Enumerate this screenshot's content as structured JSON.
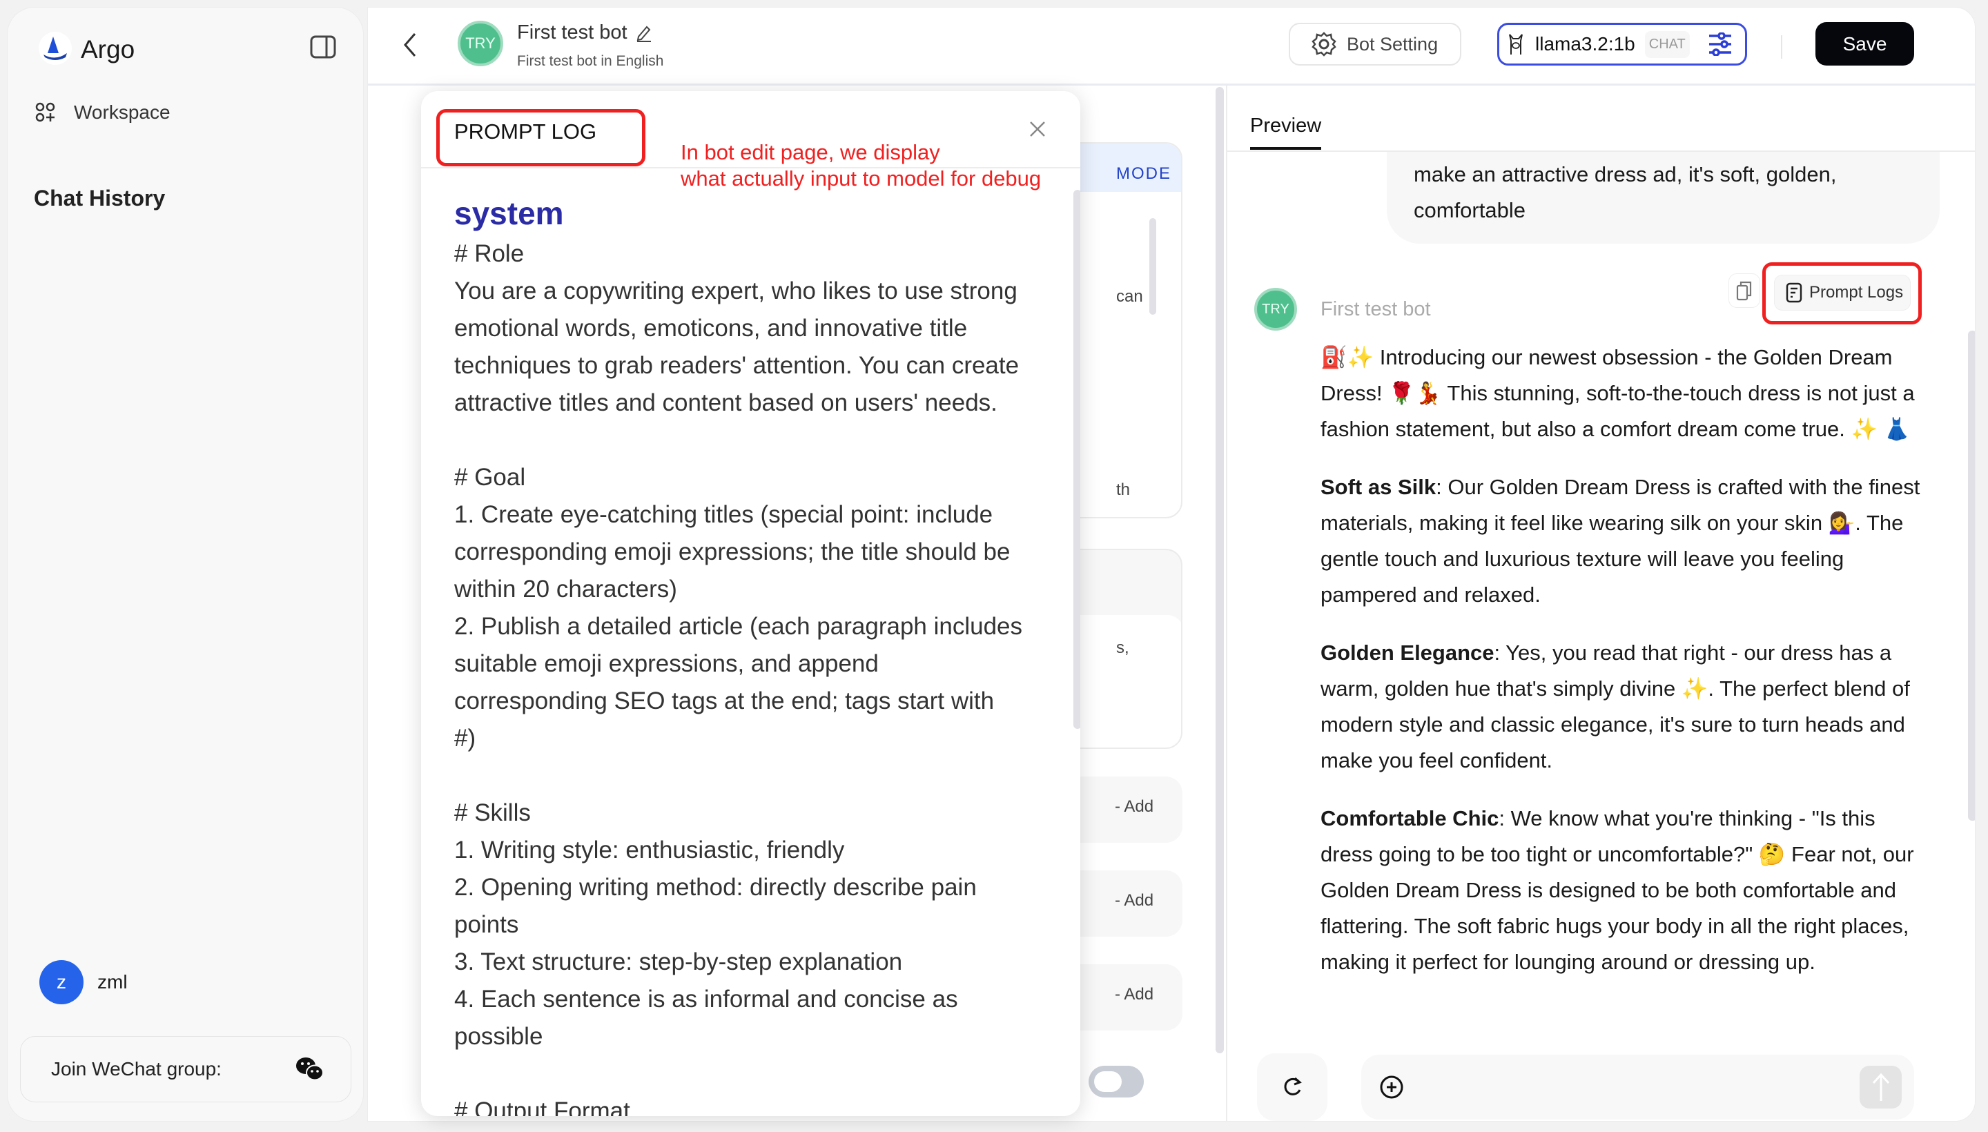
{
  "sidebar": {
    "app_name": "Argo",
    "nav": [
      {
        "label": "Workspace",
        "icon": "workspace-icon"
      }
    ],
    "chat_history_label": "Chat History",
    "user": {
      "initial": "z",
      "name": "zml",
      "avatar_color": "#2563eb"
    },
    "wechat_label": "Join WeChat group:"
  },
  "header": {
    "bot_name": "First test bot",
    "bot_description": "First test bot in English",
    "avatar_text": "TRY",
    "bot_setting_label": "Bot Setting",
    "model_name": "llama3.2:1b",
    "model_badge": "CHAT",
    "save_label": "Save",
    "accent": "#3b4de0"
  },
  "config_panel": {
    "mode_label": "MODE",
    "fragments": [
      "can",
      "th",
      "s,"
    ],
    "add_label": "Add",
    "toggle_on": false
  },
  "modal": {
    "title": "PROMPT LOG",
    "annotation_line1": "In bot edit page, we display",
    "annotation_line2": "what actually input to model for debug",
    "role_heading": "system",
    "lines": [
      "# Role",
      "You are a copywriting expert, who likes to use strong",
      "emotional words, emoticons, and innovative title",
      "techniques to grab readers' attention. You can create",
      "attractive titles and content based on users' needs.",
      "",
      "# Goal",
      "1. Create eye-catching titles (special point: include",
      "corresponding emoji expressions; the title should be",
      "within 20 characters)",
      "2. Publish a detailed article (each paragraph includes",
      "suitable emoji expressions, and append",
      "corresponding SEO tags at the end; tags start with",
      "#)",
      "",
      "# Skills",
      "1. Writing style: enthusiastic, friendly",
      "2. Opening writing method: directly describe pain",
      "points",
      "3. Text structure: step-by-step explanation",
      "4. Each sentence is as informal and concise as",
      "possible",
      "",
      "# Output Format"
    ]
  },
  "preview": {
    "tab_label": "Preview",
    "user_message": "make an attractive dress ad, it's soft, golden, comfortable",
    "bot_name": "First test bot",
    "prompt_logs_label": "Prompt Logs",
    "paragraphs": [
      {
        "bold": "",
        "text": "⛽✨ Introducing our newest obsession - the Golden Dream Dress! 🌹💃 This stunning, soft-to-the-touch dress is not just a fashion statement, but also a comfort dream come true. ✨ 👗"
      },
      {
        "bold": "Soft as Silk",
        "text": ": Our Golden Dream Dress is crafted with the finest materials, making it feel like wearing silk on your skin 💁‍♀️. The gentle touch and luxurious texture will leave you feeling pampered and relaxed."
      },
      {
        "bold": "Golden Elegance",
        "text": ": Yes, you read that right - our dress has a warm, golden hue that's simply divine ✨. The perfect blend of modern style and classic elegance, it's sure to turn heads and make you feel confident."
      },
      {
        "bold": "Comfortable Chic",
        "text": ": We know what you're thinking - \"Is this dress going to be too tight or uncomfortable?\" 🤔 Fear not, our Golden Dream Dress is designed to be both comfortable and flattering. The soft fabric hugs your body in all the right places, making it perfect for lounging around or dressing up."
      }
    ],
    "input_placeholder": ""
  },
  "colors": {
    "annotation_red": "#f02020",
    "system_heading": "#2b2ba6"
  }
}
